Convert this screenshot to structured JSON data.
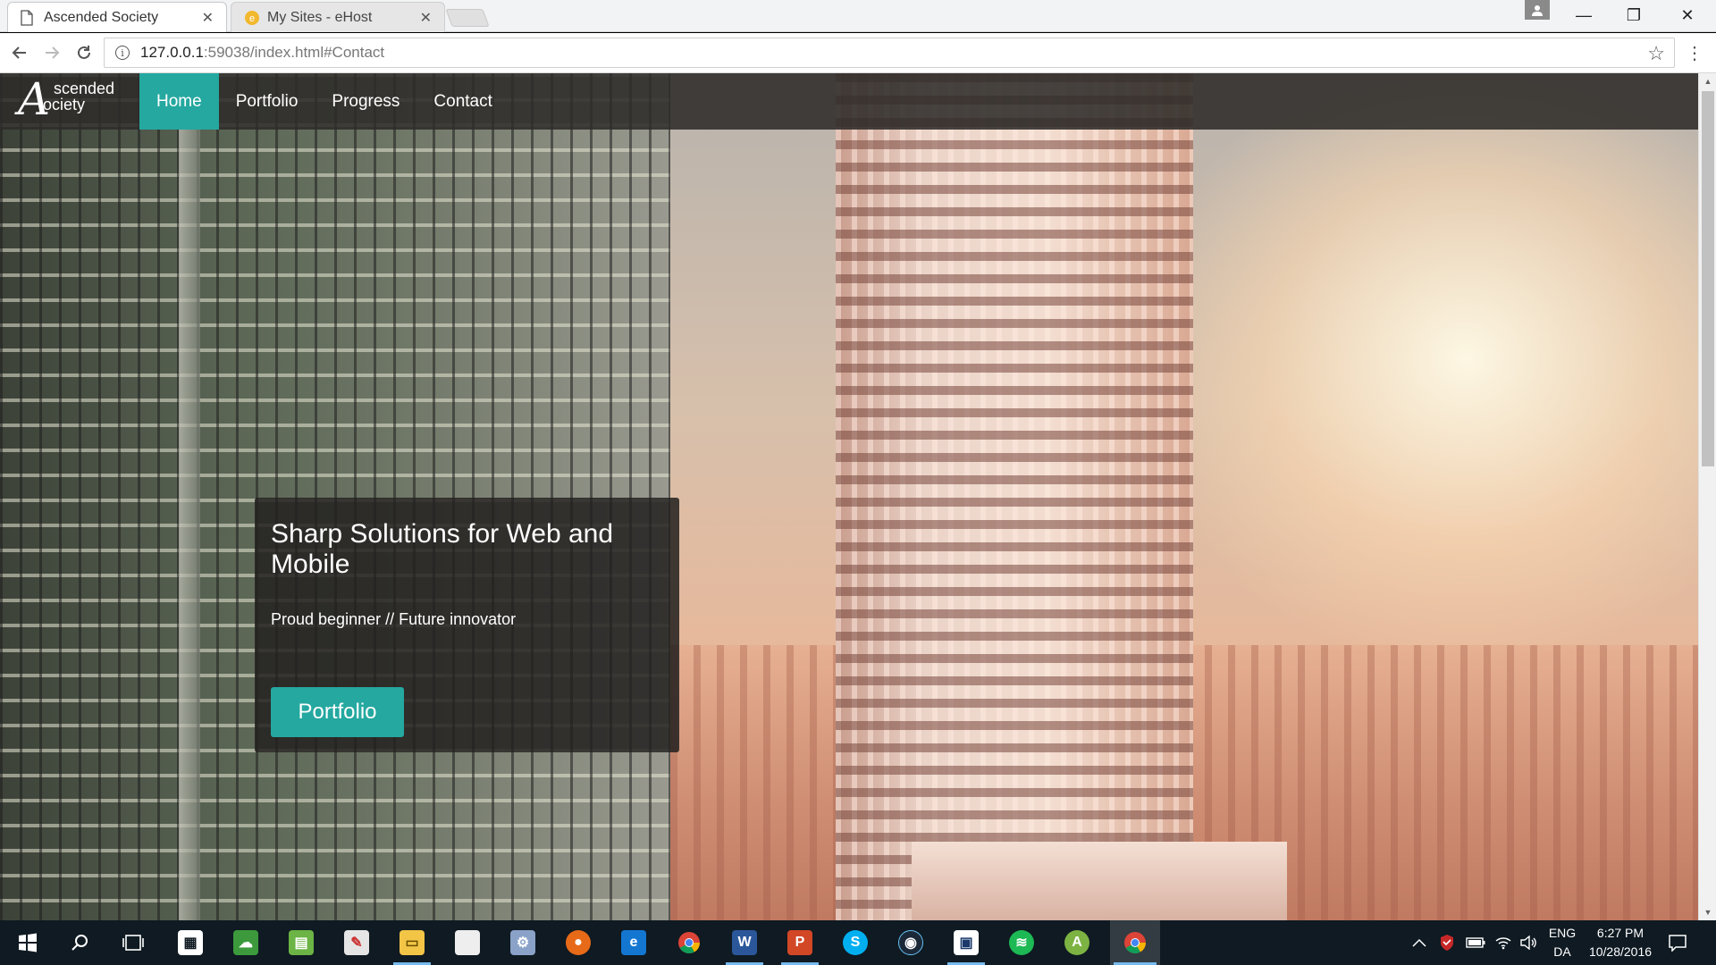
{
  "browser": {
    "tabs": [
      {
        "title": "Ascended Society",
        "active": true
      },
      {
        "title": "My Sites - eHost",
        "active": false
      }
    ],
    "url_host": "127.0.0.1",
    "url_rest": ":59038/index.html#Contact",
    "window_controls": {
      "minimize": "—",
      "restore": "❐",
      "close": "✕"
    }
  },
  "site": {
    "logo": {
      "letter": "A",
      "line1": "scended",
      "line2": "ociety"
    },
    "nav": [
      {
        "label": "Home",
        "active": true
      },
      {
        "label": "Portfolio",
        "active": false
      },
      {
        "label": "Progress",
        "active": false
      },
      {
        "label": "Contact",
        "active": false
      }
    ],
    "hero": {
      "title": "Sharp Solutions for Web and Mobile",
      "tagline": "Proud beginner // Future innovator",
      "button": "Portfolio"
    },
    "colors": {
      "accent": "#25a8a0",
      "navbar": "#2d2b29"
    }
  },
  "taskbar": {
    "icons": [
      "windows-start-icon",
      "search-icon",
      "task-view-icon",
      "store-icon",
      "xbox-icon",
      "evernote-icon",
      "paint-icon",
      "file-explorer-icon",
      "notepad-icon",
      "app-icon",
      "firefox-icon",
      "edge-icon",
      "chrome-icon",
      "word-icon",
      "powerpoint-icon",
      "skype-icon",
      "steam-icon",
      "app-icon-2",
      "spotify-icon",
      "android-studio-icon",
      "chrome-active-icon"
    ],
    "language": {
      "line1": "ENG",
      "line2": "DA"
    },
    "clock": {
      "time": "6:27 PM",
      "date": "10/28/2016"
    }
  }
}
